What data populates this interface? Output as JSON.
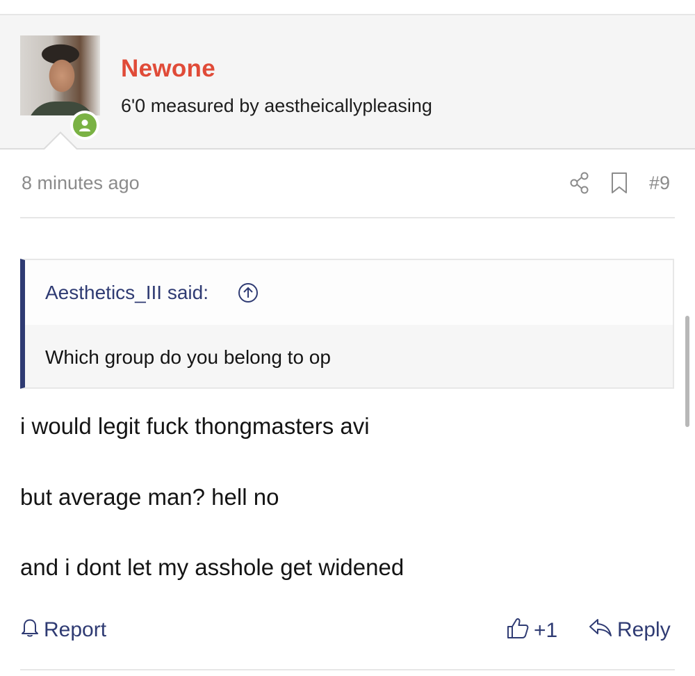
{
  "post": {
    "author": {
      "name": "Newone",
      "title": "6'0 measured by aestheicallypleasing",
      "avatar_icon": "user-photo",
      "status": "online"
    },
    "timestamp": "8 minutes ago",
    "number": "#9",
    "quote": {
      "author_label": "Aesthetics_III said:",
      "text": "Which group do you belong to op"
    },
    "body": [
      "i would legit fuck thongmasters avi",
      "but average man? hell no",
      "and i dont let my asshole get widened"
    ],
    "actions": {
      "report": "Report",
      "like_count": "+1",
      "reply": "Reply"
    }
  },
  "colors": {
    "username": "#e04b38",
    "link": "#2f3b73",
    "meta": "#8b8b8b",
    "online": "#7ab244"
  }
}
